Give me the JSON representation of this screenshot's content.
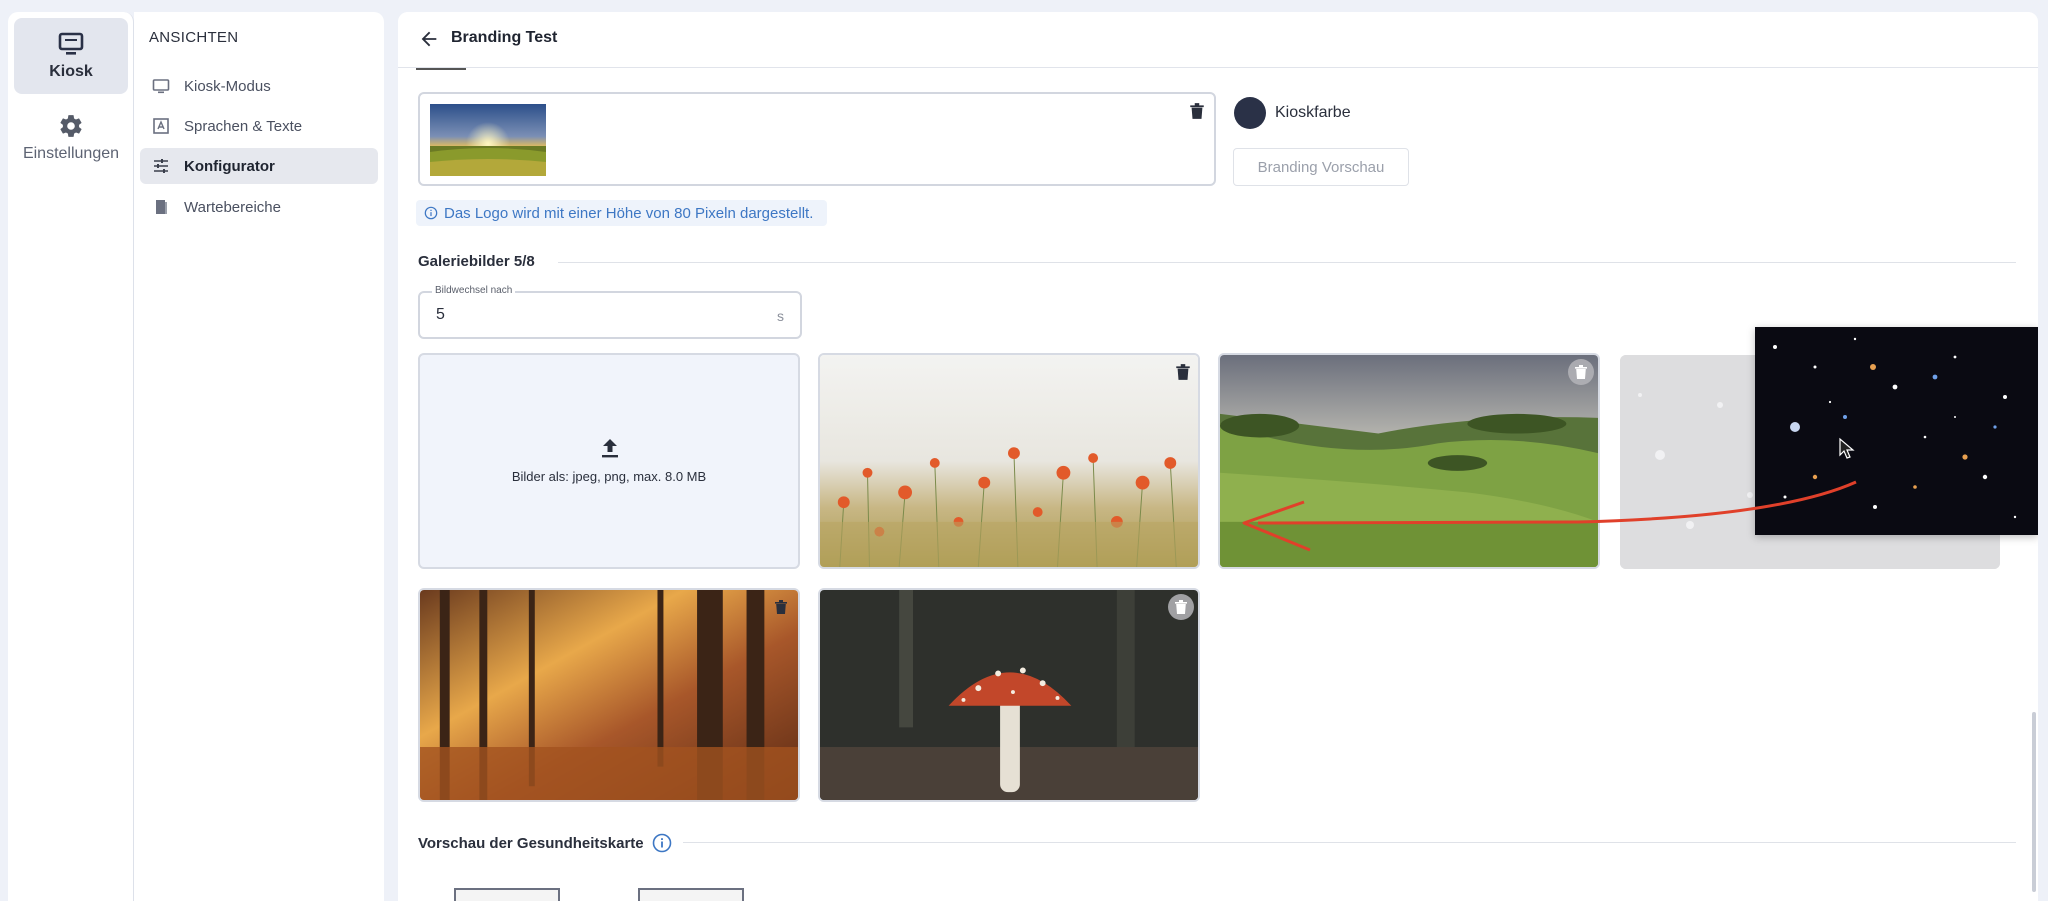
{
  "rail": {
    "items": [
      {
        "label": "Kiosk",
        "icon": "kiosk-monitor-icon",
        "active": true
      },
      {
        "label": "Einstellungen",
        "icon": "gear-icon",
        "active": false
      }
    ]
  },
  "nav": {
    "heading": "ANSICHTEN",
    "items": [
      {
        "label": "Kiosk-Modus",
        "icon": "monitor-icon"
      },
      {
        "label": "Sprachen & Texte",
        "icon": "translate-icon"
      },
      {
        "label": "Konfigurator",
        "icon": "sliders-icon",
        "active": true
      },
      {
        "label": "Wartebereiche",
        "icon": "door-icon"
      }
    ]
  },
  "header": {
    "title": "Branding Test"
  },
  "branding": {
    "kiosk_color_label": "Kioskfarbe",
    "kiosk_color": "#2a3147",
    "preview_button": "Branding Vorschau",
    "logo_note": "Das Logo wird mit einer Höhe von 80 Pixeln dargestellt."
  },
  "gallery": {
    "title": "Galeriebilder 5/8",
    "interval_label": "Bildwechsel nach",
    "interval_value": "5",
    "interval_unit": "s",
    "upload_text": "Bilder als: jpeg, png, max. 8.0 MB",
    "images": [
      "poppy-field",
      "green-hills",
      "galaxy-stars",
      "autumn-forest",
      "mushroom"
    ]
  },
  "health_card": {
    "title": "Vorschau der Gesundheitskarte"
  },
  "colors": {
    "accent": "#3d77c4",
    "drag_arrow": "#e0402a"
  }
}
